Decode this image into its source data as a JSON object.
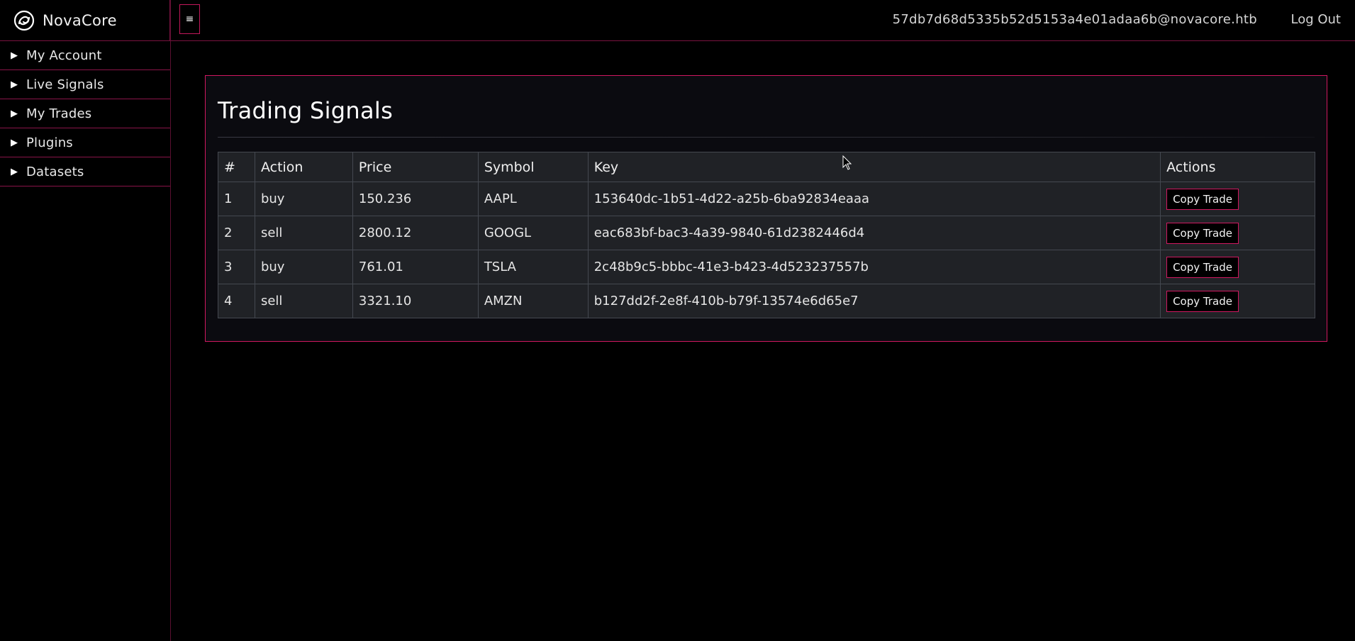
{
  "brand": {
    "name": "NovaCore",
    "logo_icon": "swirl-logo-icon"
  },
  "sidebar": {
    "items": [
      {
        "label": "My Account",
        "icon": "triangle-right-icon"
      },
      {
        "label": "Live Signals",
        "icon": "triangle-right-icon"
      },
      {
        "label": "My Trades",
        "icon": "triangle-right-icon"
      },
      {
        "label": "Plugins",
        "icon": "triangle-right-icon"
      },
      {
        "label": "Datasets",
        "icon": "triangle-right-icon"
      }
    ]
  },
  "topbar": {
    "menu_toggle_glyph": "≡",
    "user_email": "57db7d68d5335b52d5153a4e01adaa6b@novacore.htb",
    "logout_label": "Log Out"
  },
  "main": {
    "title": "Trading Signals",
    "table": {
      "columns": [
        "#",
        "Action",
        "Price",
        "Symbol",
        "Key",
        "Actions"
      ],
      "rows": [
        {
          "num": "1",
          "action": "buy",
          "price": "150.236",
          "symbol": "AAPL",
          "key": "153640dc-1b51-4d22-a25b-6ba92834eaaa",
          "button": "Copy Trade"
        },
        {
          "num": "2",
          "action": "sell",
          "price": "2800.12",
          "symbol": "GOOGL",
          "key": "eac683bf-bac3-4a39-9840-61d2382446d4",
          "button": "Copy Trade"
        },
        {
          "num": "3",
          "action": "buy",
          "price": "761.01",
          "symbol": "TSLA",
          "key": "2c48b9c5-bbbc-41e3-b423-4d523237557b",
          "button": "Copy Trade"
        },
        {
          "num": "4",
          "action": "sell",
          "price": "3321.10",
          "symbol": "AMZN",
          "key": "b127dd2f-2e8f-410b-b79f-13574e6d65e7",
          "button": "Copy Trade"
        }
      ]
    }
  },
  "colors": {
    "accent": "#d01860",
    "background": "#000000",
    "panel": "#0b0b10",
    "table": "#202226"
  }
}
